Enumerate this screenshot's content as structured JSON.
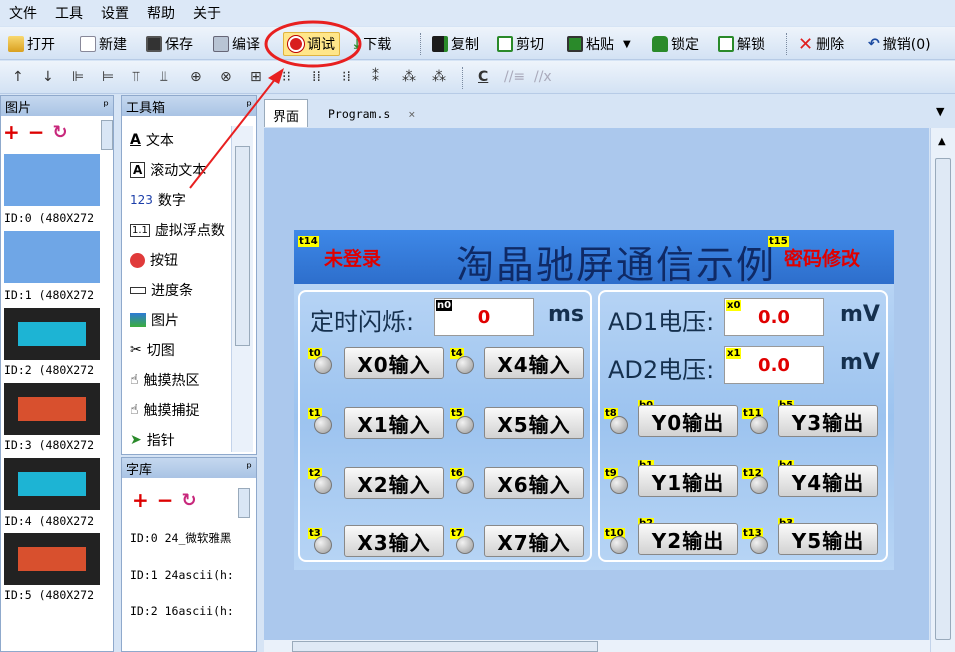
{
  "menu": [
    "文件",
    "工具",
    "设置",
    "帮助",
    "关于"
  ],
  "toolbar1": {
    "open": "打开",
    "new": "新建",
    "save": "保存",
    "compile": "编译",
    "debug": "调试",
    "download": "下载",
    "copy": "复制",
    "cut": "剪切",
    "paste": "粘贴",
    "lock": "锁定",
    "unlock": "解锁",
    "delete": "删除",
    "undo": "撤销(0)"
  },
  "toolbar2": {
    "c_btn": "C"
  },
  "panels": {
    "pictures": "图片",
    "toolbox": "工具箱",
    "fontlib": "字库",
    "pin": "ᵖ"
  },
  "pictures": [
    {
      "id": "ID:0  (480X272"
    },
    {
      "id": "ID:1  (480X272"
    },
    {
      "id": "ID:2  (480X272"
    },
    {
      "id": "ID:3  (480X272"
    },
    {
      "id": "ID:4  (480X272"
    },
    {
      "id": "ID:5  (480X272"
    }
  ],
  "tools": [
    "文本",
    "滚动文本",
    "数字",
    "虚拟浮点数",
    "按钮",
    "进度条",
    "图片",
    "切图",
    "触摸热区",
    "触摸捕捉",
    "指针"
  ],
  "fonts": [
    "ID:0  24_微软雅黑",
    "ID:1  24ascii(h:",
    "ID:2  16ascii(h:"
  ],
  "tabs": {
    "interface": "界面",
    "program": "Program.s",
    "close": "×"
  },
  "hmi": {
    "title": "淘晶驰屏通信示例",
    "t14_tag": "t14",
    "t14_text": "未登录",
    "t15_tag": "t15",
    "t15_text": "密码修改",
    "timer_label": "定时闪烁:",
    "n0_tag": "n0",
    "n0_value": "0",
    "ms_unit": "ms",
    "ad1_label": "AD1电压:",
    "x0_tag": "x0",
    "ad1_value": "0.0",
    "ad2_label": "AD2电压:",
    "x1_tag": "x1",
    "ad2_value": "0.0",
    "mv_unit": "mV",
    "inputs_left": [
      {
        "tag": "t0",
        "label": "X0输入"
      },
      {
        "tag": "t1",
        "label": "X1输入"
      },
      {
        "tag": "t2",
        "label": "X2输入"
      },
      {
        "tag": "t3",
        "label": "X3输入"
      }
    ],
    "inputs_right": [
      {
        "tag": "t4",
        "label": "X4输入"
      },
      {
        "tag": "t5",
        "label": "X5输入"
      },
      {
        "tag": "t6",
        "label": "X6输入"
      },
      {
        "tag": "t7",
        "label": "X7输入"
      }
    ],
    "outputs_left": [
      {
        "led": "t8",
        "btn": "b0",
        "label": "Y0输出"
      },
      {
        "led": "t9",
        "btn": "b1",
        "label": "Y1输出"
      },
      {
        "led": "t10",
        "btn": "b2",
        "label": "Y2输出"
      }
    ],
    "outputs_right": [
      {
        "led": "t11",
        "btn": "b5",
        "label": "Y3输出"
      },
      {
        "led": "t12",
        "btn": "b4",
        "label": "Y4输出"
      },
      {
        "led": "t13",
        "btn": "b3",
        "label": "Y5输出"
      }
    ]
  },
  "colors": {
    "highlight_circle": "#e82020",
    "arrow": "#e82020",
    "value_red": "#e00000",
    "tag_yellow": "#ffff00"
  }
}
